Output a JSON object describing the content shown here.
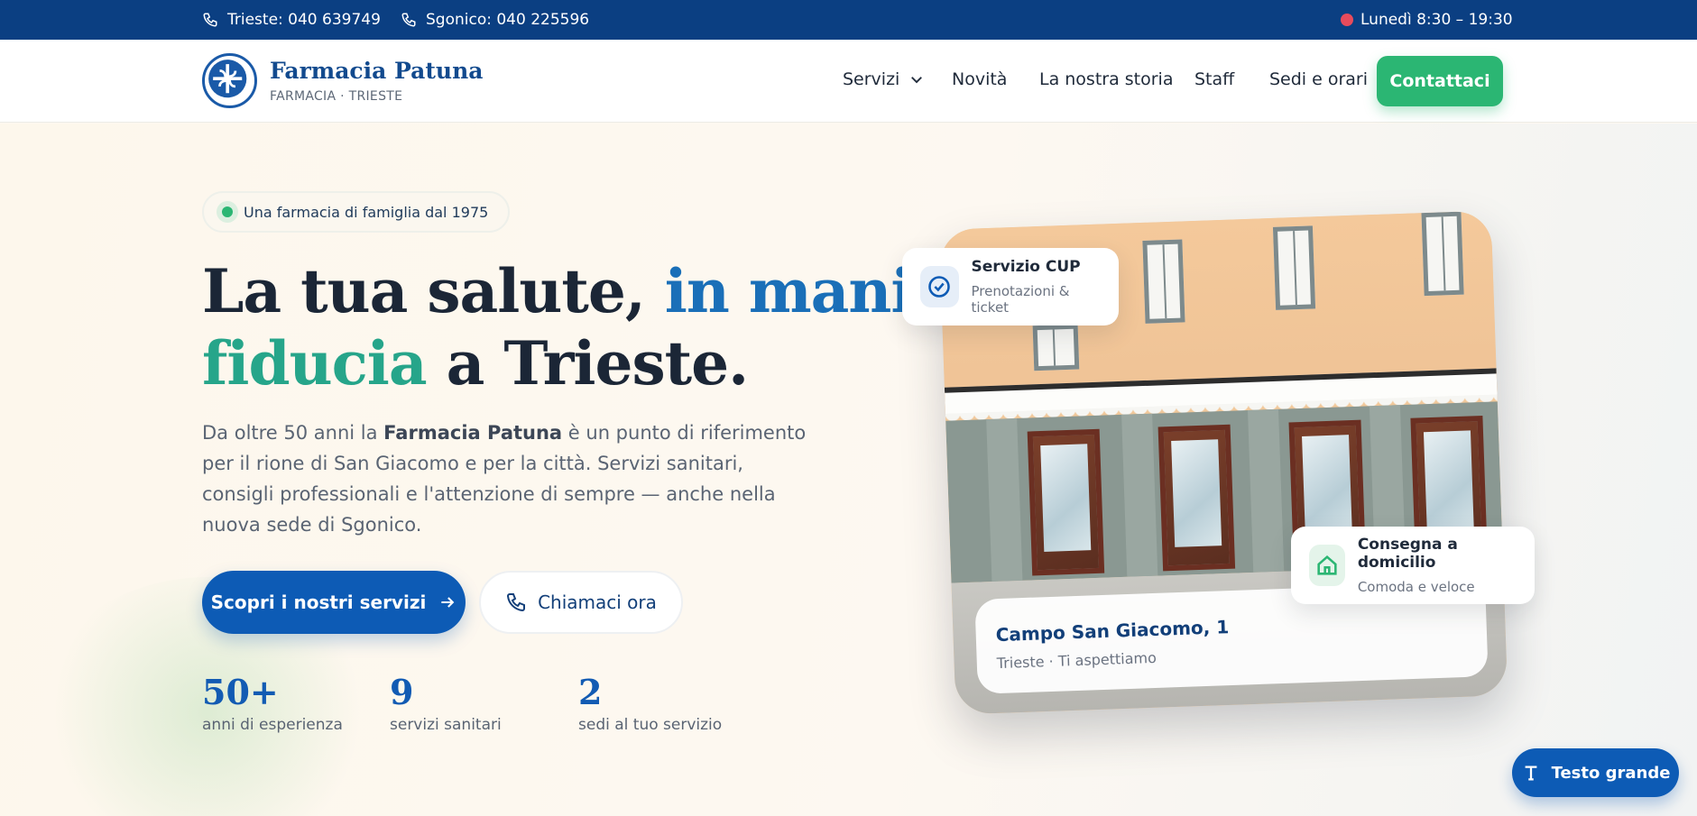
{
  "topbar": {
    "phone1": "Trieste: 040 639749",
    "phone2": "Sgonico: 040 225596",
    "hours": "Lunedì 8:30 – 19:30"
  },
  "brand": {
    "name": "Farmacia Patuna",
    "tagline": "FARMACIA · TRIESTE"
  },
  "nav": {
    "items": [
      "Servizi",
      "Novità",
      "La nostra storia",
      "Staff",
      "Sedi e orari"
    ],
    "cta": "Contattaci"
  },
  "hero": {
    "badge": "Una farmacia di famiglia dal 1975",
    "title_a": "La tua salute, ",
    "title_b": "in mani di",
    "title_c": "fiducia",
    "title_d": " a Trieste.",
    "lead_a": "Da oltre 50 anni la ",
    "lead_b": "Farmacia Patuna",
    "lead_c": " è un punto di riferimento per il rione di San Giacomo e per la città. Servizi sanitari, consigli professionali e l'attenzione di sempre — anche nella nuova sede di Sgonico.",
    "primary_btn": "Scopri i nostri servizi",
    "secondary_btn": "Chiamaci ora"
  },
  "stats": [
    {
      "value": "50+",
      "label": "anni di esperienza"
    },
    {
      "value": "9",
      "label": "servizi sanitari"
    },
    {
      "value": "2",
      "label": "sedi al tuo servizio"
    }
  ],
  "photo": {
    "address_title": "Campo San Giacomo, 1",
    "address_sub": "Trieste · Ti aspettiamo"
  },
  "cards": {
    "cup_title": "Servizio CUP",
    "cup_sub": "Prenotazioni & ticket",
    "delivery_title": "Consegna a domicilio",
    "delivery_sub": "Comoda e veloce"
  },
  "accessibility": {
    "text_size_btn": "Testo grande"
  },
  "colors": {
    "topbar": "#0b3f82",
    "primary": "#0d5bb5",
    "accent_green": "#2bb673",
    "teal": "#26a58a"
  }
}
